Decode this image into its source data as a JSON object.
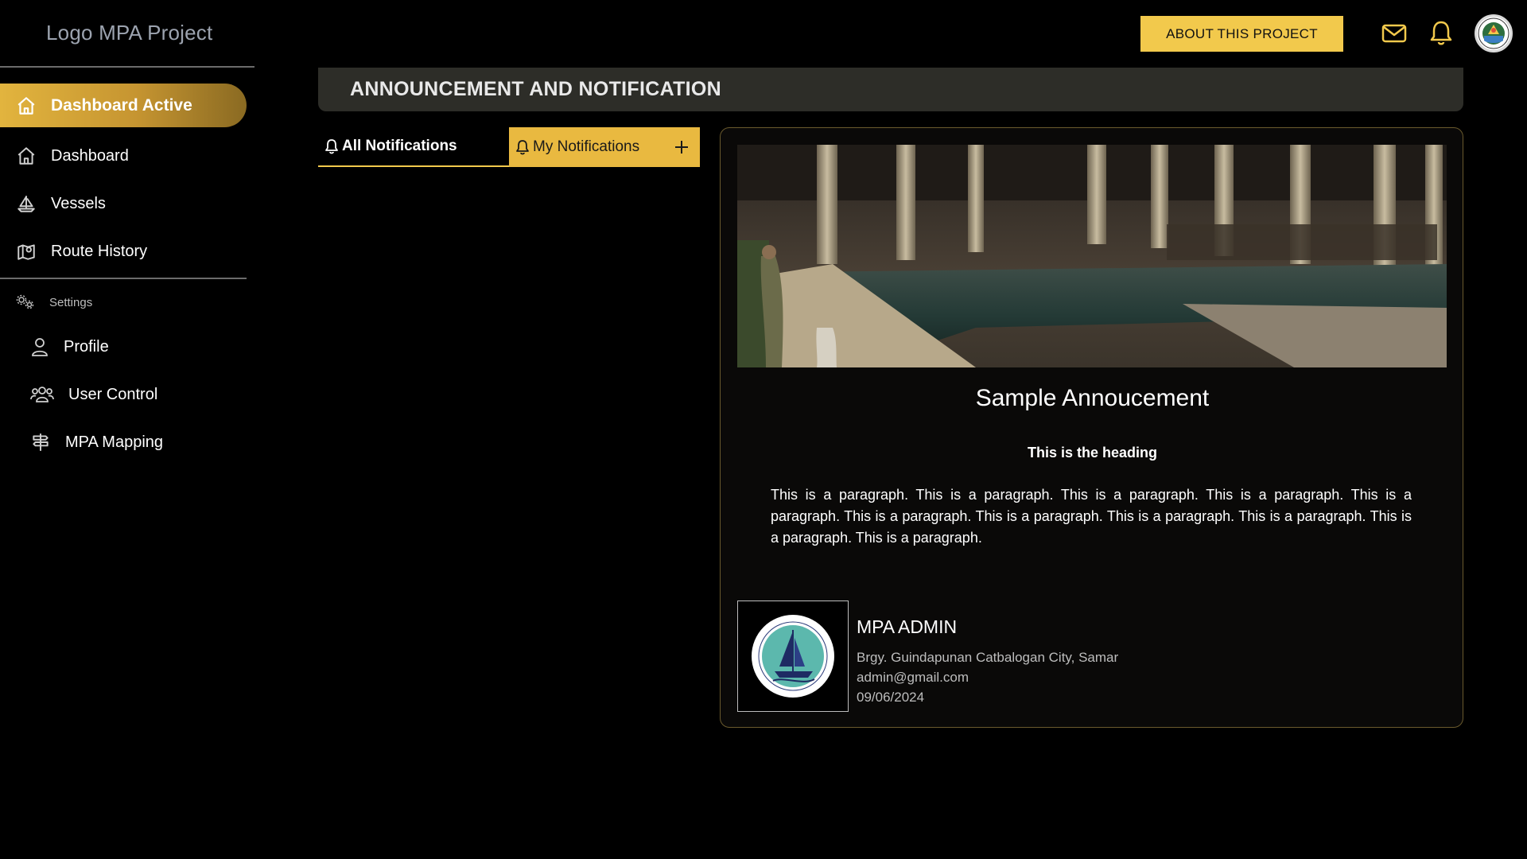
{
  "sidebar": {
    "logo_text": "Logo MPA Project",
    "active_item": {
      "label": "Dashboard Active",
      "icon": "home-icon"
    },
    "items": [
      {
        "label": "Dashboard",
        "icon": "home-icon"
      },
      {
        "label": "Vessels",
        "icon": "sailboat-icon"
      },
      {
        "label": "Route History",
        "icon": "map-pin-icon"
      }
    ],
    "settings_label": "Settings",
    "settings_items": [
      {
        "label": "Profile",
        "icon": "user-icon"
      },
      {
        "label": "User Control",
        "icon": "users-icon"
      },
      {
        "label": "MPA Mapping",
        "icon": "signpost-icon"
      }
    ]
  },
  "topbar": {
    "about_label": "ABOUT THIS PROJECT",
    "icons": [
      "mail-icon",
      "bell-icon"
    ],
    "accent_color": "#f2c94c"
  },
  "header": {
    "title": "ANNOUNCEMENT AND NOTIFICATION"
  },
  "tabs": {
    "all_label": "All Notifications",
    "mine_label": "My Notifications",
    "add_icon": "plus-icon"
  },
  "announcement": {
    "title": "Sample Annoucement",
    "heading": "This is the heading",
    "paragraph": "This is a paragraph. This is a paragraph. This is a paragraph. This is a paragraph. This is a paragraph. This is a paragraph. This is a paragraph. This is a paragraph. This is a paragraph. This is a paragraph. This is a paragraph.",
    "author": {
      "name": "MPA ADMIN",
      "address": "Brgy. Guindapunan Catbalogan City, Samar",
      "email": "admin@gmail.com",
      "date": "09/06/2024"
    }
  }
}
